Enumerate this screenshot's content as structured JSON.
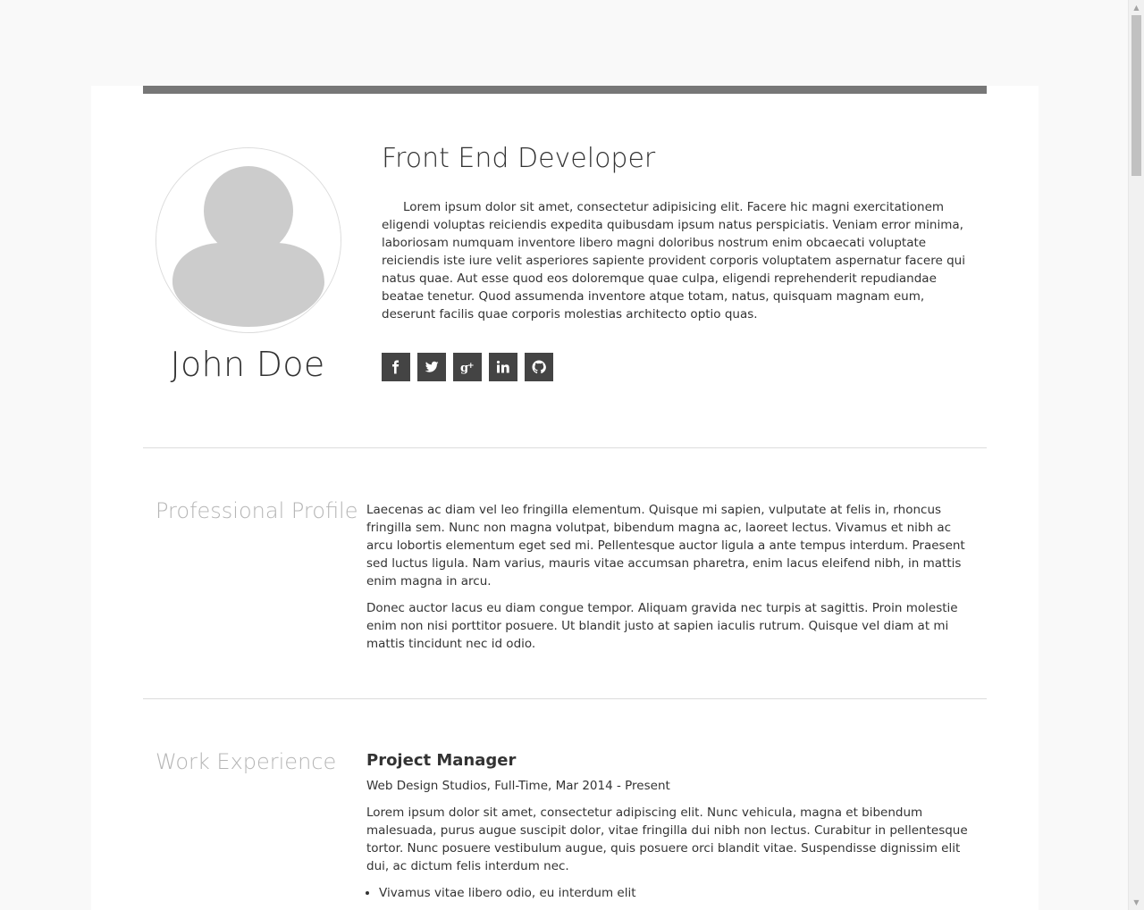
{
  "header": {
    "name": "John Doe",
    "job_title": "Front End Developer",
    "bio": "Lorem ipsum dolor sit amet, consectetur adipisicing elit. Facere hic magni exercitationem eligendi voluptas reiciendis expedita quibusdam ipsum natus perspiciatis. Veniam error minima, laboriosam numquam inventore libero magni doloribus nostrum enim obcaecati voluptate reiciendis iste iure velit asperiores sapiente provident corporis voluptatem aspernatur facere qui natus quae. Aut esse quod eos doloremque quae culpa, eligendi reprehenderit repudiandae beatae tenetur. Quod assumenda inventore atque totam, natus, quisquam magnam eum, deserunt facilis quae corporis molestias architecto optio quas.",
    "social": [
      {
        "icon": "facebook-icon"
      },
      {
        "icon": "twitter-icon"
      },
      {
        "icon": "google-plus-icon"
      },
      {
        "icon": "linkedin-icon"
      },
      {
        "icon": "github-icon"
      }
    ]
  },
  "profile": {
    "title": "Professional Profile",
    "paragraphs": [
      "Laecenas ac diam vel leo fringilla elementum. Quisque mi sapien, vulputate at felis in, rhoncus fringilla sem. Nunc non magna volutpat, bibendum magna ac, laoreet lectus. Vivamus et nibh ac arcu lobortis elementum eget sed mi. Pellentesque auctor ligula a ante tempus interdum. Praesent sed luctus ligula. Nam varius, mauris vitae accumsan pharetra, enim lacus eleifend nibh, in mattis enim magna in arcu.",
      "Donec auctor lacus eu diam congue tempor. Aliquam gravida nec turpis at sagittis. Proin molestie enim non nisi porttitor posuere. Ut blandit justo at sapien iaculis rutrum. Quisque vel diam at mi mattis tincidunt nec id odio."
    ]
  },
  "experience": {
    "title": "Work Experience",
    "jobs": [
      {
        "role": "Project Manager",
        "meta": "Web Design Studios, Full-Time, Mar 2014 - Present",
        "description": "Lorem ipsum dolor sit amet, consectetur adipiscing elit. Nunc vehicula, magna et bibendum malesuada, purus augue suscipit dolor, vitae fringilla dui nibh non lectus. Curabitur in pellentesque tortor. Nunc posuere vestibulum augue, quis posuere orci blandit vitae. Suspendisse dignissim elit dui, ac dictum felis interdum nec.",
        "bullets": [
          "Vivamus vitae libero odio, eu interdum elit"
        ]
      }
    ]
  },
  "colors": {
    "topbar": "#777777",
    "social_bg": "#444444",
    "section_title": "#b5b5b5",
    "avatar_fill": "#cccccc"
  }
}
